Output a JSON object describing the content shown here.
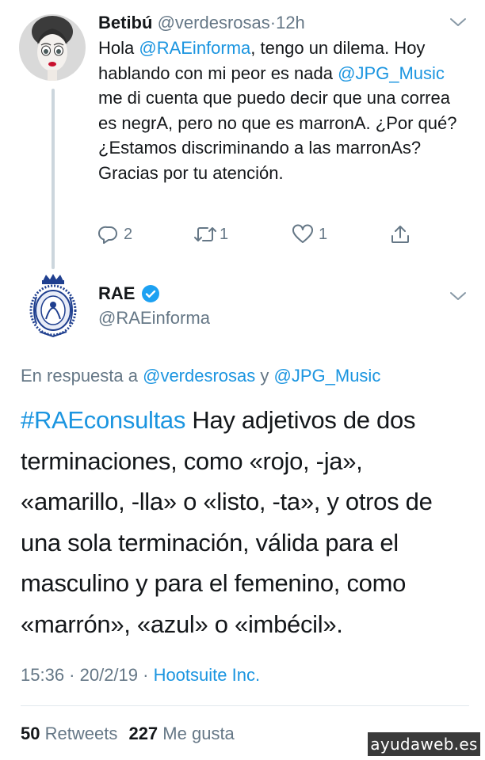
{
  "tweet1": {
    "name": "Betibú",
    "handle": "@verdesrosas",
    "separator": "·",
    "time": "12h",
    "avatar_icon": "woman-portrait-avatar",
    "text": {
      "p1": "Hola ",
      "m1": "@RAEinforma",
      "p2": ", tengo un dilema. Hoy hablando con mi peor es nada ",
      "m2": "@JPG_Music",
      "p3": " me di cuenta que puedo decir que una correa es negrA, pero no que es marronA. ¿Por qué? ¿Estamos discriminando a las marronAs? Gracias por tu atención."
    },
    "actions": {
      "reply_count": "2",
      "retweet_count": "1",
      "like_count": "1"
    }
  },
  "tweet2": {
    "name": "RAE",
    "handle": "@RAEinforma",
    "avatar_icon": "rae-seal-avatar",
    "verified_icon": "verified-badge-icon",
    "reply_prefix": "En respuesta a ",
    "reply_user1": "@verdesrosas",
    "reply_and": " y ",
    "reply_user2": "@JPG_Music",
    "hashtag": "#RAEconsultas",
    "text": " Hay adjetivos de dos terminaciones, como «rojo, -ja», «amarillo, -lla» o «listo, -ta», y otros de una sola terminación, válida para el masculino y para el femenino, como «marrón», «azul» o «imbécil».",
    "timestamp": "15:36 · 20/2/19 · ",
    "source": "Hootsuite Inc.",
    "retweets_count": "50",
    "retweets_label": "Retweets",
    "likes_count": "227",
    "likes_label": "Me gusta"
  },
  "watermark": "ayudaweb.es",
  "colors": {
    "link": "#1b95e0",
    "secondary": "#657786",
    "primary_text": "#14171a",
    "divider": "#e1e8ed"
  }
}
